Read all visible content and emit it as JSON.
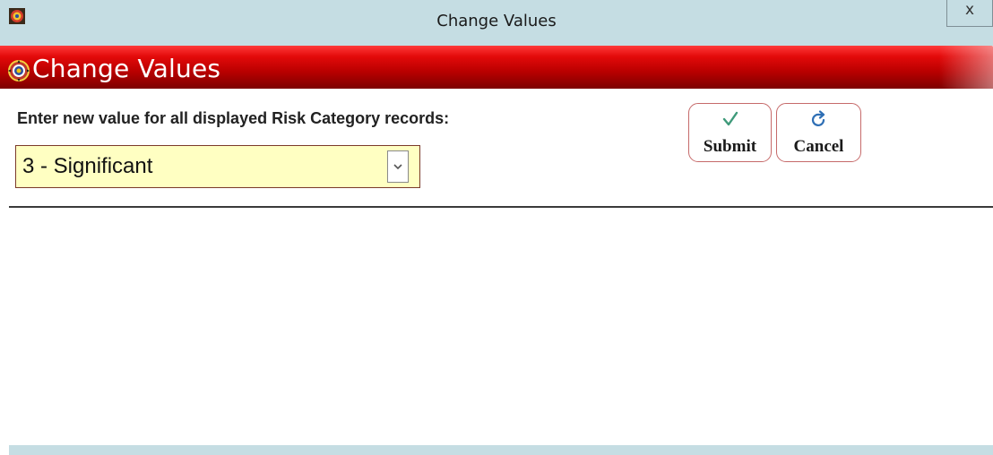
{
  "window": {
    "title": "Change Values",
    "close_label": "x"
  },
  "banner": {
    "title": "Change Values",
    "icon": "app-logo-icon"
  },
  "form": {
    "prompt": "Enter new value for all displayed Risk Category records:",
    "select": {
      "selected_value": "3 - Significant",
      "arrow_icon": "chevron-down-icon"
    }
  },
  "actions": {
    "submit": {
      "label": "Submit",
      "icon": "checkmark-icon",
      "icon_color": "#3f9a7a"
    },
    "cancel": {
      "label": "Cancel",
      "icon": "redo-arrow-icon",
      "icon_color": "#2f6fb5"
    }
  },
  "colors": {
    "titlebar": "#c5dde3",
    "banner_red": "#d00000",
    "field_background": "#ffffc2",
    "button_border": "#c66a6a"
  }
}
